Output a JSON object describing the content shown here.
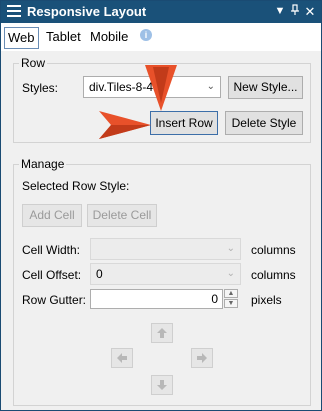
{
  "window": {
    "title": "Responsive Layout",
    "dropdown_icon": "dropdown-arrow",
    "pin_icon": "pin",
    "close_icon": "close"
  },
  "tabs": [
    {
      "label": "Web",
      "active": true
    },
    {
      "label": "Tablet",
      "active": false
    },
    {
      "label": "Mobile",
      "active": false
    }
  ],
  "row_group": {
    "label": "Row",
    "styles_label": "Styles:",
    "styles_value": "div.Tiles-8-4",
    "new_style_button": "New Style...",
    "insert_row_button": "Insert Row",
    "delete_style_button": "Delete Style"
  },
  "manage_group": {
    "label": "Manage",
    "selected_row_style_label": "Selected Row Style:",
    "add_cell_button": "Add Cell",
    "delete_cell_button": "Delete Cell",
    "cell_width_label": "Cell Width:",
    "cell_width_value": "",
    "cell_width_unit": "columns",
    "cell_offset_label": "Cell Offset:",
    "cell_offset_value": "0",
    "cell_offset_unit": "columns",
    "row_gutter_label": "Row Gutter:",
    "row_gutter_value": "0",
    "row_gutter_unit": "pixels"
  },
  "colors": {
    "titlebar": "#1a5179",
    "callout_arrow": "#e8512a"
  }
}
